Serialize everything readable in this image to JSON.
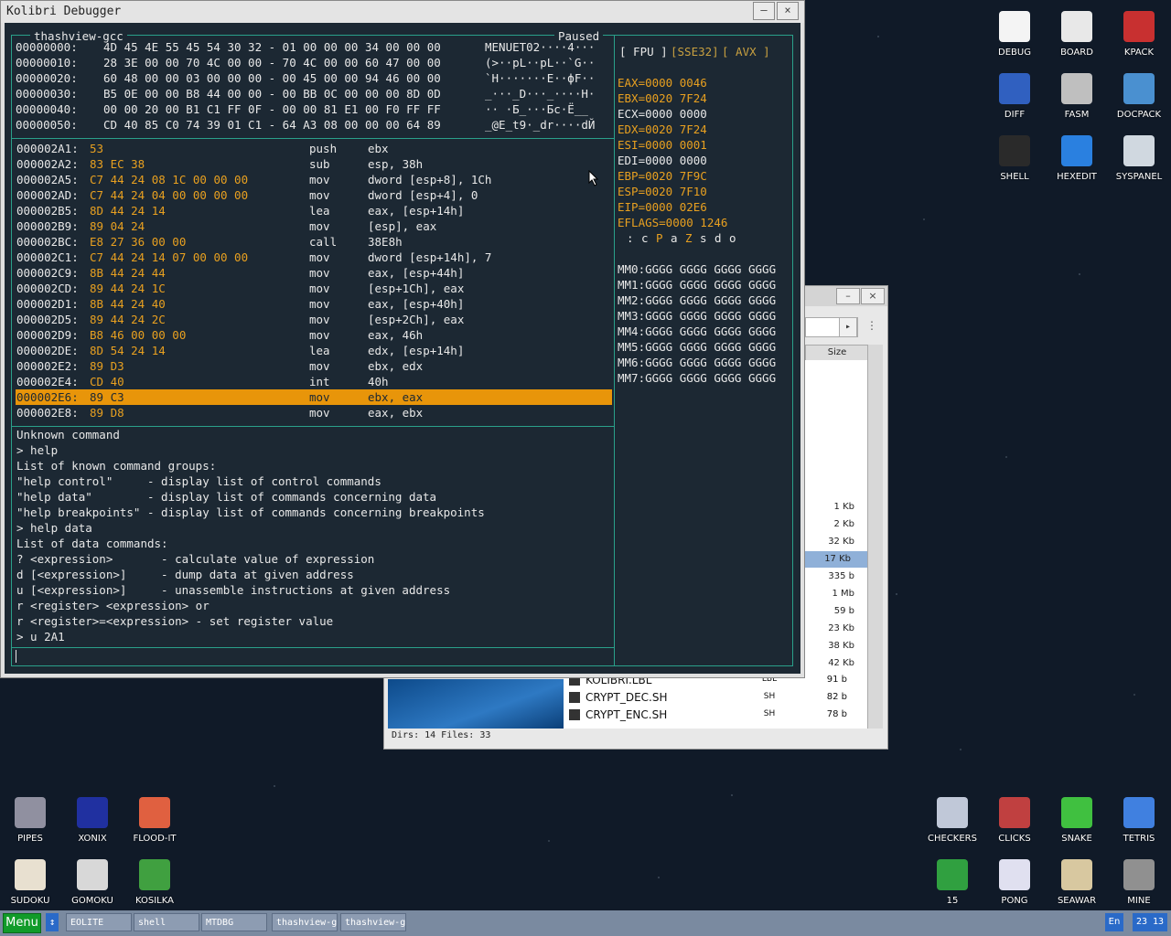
{
  "window": {
    "title": "Kolibri Debugger",
    "minimize": "–",
    "close": "×",
    "program": "thashview-gcc",
    "status": "Paused"
  },
  "dump": [
    {
      "addr": "00000000:",
      "hex": "4D 45 4E 55 45 54 30 32 - 01 00 00 00 34 00 00 00",
      "ascii": "MENUET02····4···"
    },
    {
      "addr": "00000010:",
      "hex": "28 3E 00 00 70 4C 00 00 - 70 4C 00 00 60 47 00 00",
      "ascii": "(>··pL··pL··`G··"
    },
    {
      "addr": "00000020:",
      "hex": "60 48 00 00 03 00 00 00 - 00 45 00 00 94 46 00 00",
      "ascii": "`H·······E··фF··"
    },
    {
      "addr": "00000030:",
      "hex": "B5 0E 00 00 B8 44 00 00 - 00 BB 0C 00 00 00 8D 0D",
      "ascii": "_···_D···_····Н·"
    },
    {
      "addr": "00000040:",
      "hex": "00 00 20 00 B1 C1 FF 0F - 00 00 81 E1 00 F0 FF FF",
      "ascii": "·· ·Б_···Бс·Ё__"
    },
    {
      "addr": "00000050:",
      "hex": "CD 40 85 C0 74 39 01 C1 - 64 A3 08 00 00 00 64 89",
      "ascii": "_@Е_t9·_dr····dЙ"
    }
  ],
  "disasm": [
    {
      "addr": "000002A1:",
      "bytes": "53",
      "mnem": "push",
      "ops": "ebx"
    },
    {
      "addr": "000002A2:",
      "bytes": "83 EC 38",
      "mnem": "sub",
      "ops": "esp, 38h"
    },
    {
      "addr": "000002A5:",
      "bytes": "C7 44 24 08 1C 00 00 00",
      "mnem": "mov",
      "ops": "dword [esp+8], 1Ch"
    },
    {
      "addr": "000002AD:",
      "bytes": "C7 44 24 04 00 00 00 00",
      "mnem": "mov",
      "ops": "dword [esp+4], 0"
    },
    {
      "addr": "000002B5:",
      "bytes": "8D 44 24 14",
      "mnem": "lea",
      "ops": "eax, [esp+14h]"
    },
    {
      "addr": "000002B9:",
      "bytes": "89 04 24",
      "mnem": "mov",
      "ops": "[esp], eax"
    },
    {
      "addr": "000002BC:",
      "bytes": "E8 27 36 00 00",
      "mnem": "call",
      "ops": "38E8h"
    },
    {
      "addr": "000002C1:",
      "bytes": "C7 44 24 14 07 00 00 00",
      "mnem": "mov",
      "ops": "dword [esp+14h], 7"
    },
    {
      "addr": "000002C9:",
      "bytes": "8B 44 24 44",
      "mnem": "mov",
      "ops": "eax, [esp+44h]"
    },
    {
      "addr": "000002CD:",
      "bytes": "89 44 24 1C",
      "mnem": "mov",
      "ops": "[esp+1Ch], eax"
    },
    {
      "addr": "000002D1:",
      "bytes": "8B 44 24 40",
      "mnem": "mov",
      "ops": "eax, [esp+40h]"
    },
    {
      "addr": "000002D5:",
      "bytes": "89 44 24 2C",
      "mnem": "mov",
      "ops": "[esp+2Ch], eax"
    },
    {
      "addr": "000002D9:",
      "bytes": "B8 46 00 00 00",
      "mnem": "mov",
      "ops": "eax, 46h"
    },
    {
      "addr": "000002DE:",
      "bytes": "8D 54 24 14",
      "mnem": "lea",
      "ops": "edx, [esp+14h]"
    },
    {
      "addr": "000002E2:",
      "bytes": "89 D3",
      "mnem": "mov",
      "ops": "ebx, edx"
    },
    {
      "addr": "000002E4:",
      "bytes": "CD 40",
      "mnem": "int",
      "ops": "40h"
    },
    {
      "addr": "000002E6:",
      "bytes": "89 C3",
      "mnem": "mov",
      "ops": "ebx, eax",
      "current": true
    },
    {
      "addr": "000002E8:",
      "bytes": "89 D8",
      "mnem": "mov",
      "ops": "eax, ebx"
    }
  ],
  "console": [
    "Unknown command",
    "> help",
    "List of known command groups:",
    "\"help control\"     - display list of control commands",
    "\"help data\"        - display list of commands concerning data",
    "\"help breakpoints\" - display list of commands concerning breakpoints",
    "> help data",
    "List of data commands:",
    "? <expression>       - calculate value of expression",
    "d [<expression>]     - dump data at given address",
    "u [<expression>]     - unassemble instructions at given address",
    "r <register> <expression> or",
    "r <register>=<expression> - set register value",
    "> u 2A1"
  ],
  "command_input": "",
  "reg_tabs": {
    "fpu": "[ FPU ]",
    "sse": "[SSE32]",
    "avx": "[ AVX ]"
  },
  "registers": [
    {
      "text": "EAX=0000 0046",
      "changed": true
    },
    {
      "text": "EBX=0020 7F24",
      "changed": true
    },
    {
      "text": "ECX=0000 0000",
      "changed": false
    },
    {
      "text": "EDX=0020 7F24",
      "changed": true
    },
    {
      "text": "ESI=0000 0001",
      "changed": true
    },
    {
      "text": "EDI=0000 0000",
      "changed": false
    },
    {
      "text": "EBP=0020 7F9C",
      "changed": true
    },
    {
      "text": "ESP=0020 7F10",
      "changed": true
    },
    {
      "text": "EIP=0000 02E6",
      "changed": true
    },
    {
      "text": "EFLAGS=0000 1246",
      "changed": true
    }
  ],
  "flags": [
    {
      "ch": ":",
      "set": false
    },
    {
      "ch": "c",
      "set": false
    },
    {
      "ch": "P",
      "set": true
    },
    {
      "ch": "a",
      "set": false
    },
    {
      "ch": "Z",
      "set": true
    },
    {
      "ch": "s",
      "set": false
    },
    {
      "ch": "d",
      "set": false
    },
    {
      "ch": "o",
      "set": false
    }
  ],
  "mmx": [
    "MM0:GGGG GGGG GGGG GGGG",
    "MM1:GGGG GGGG GGGG GGGG",
    "MM2:GGGG GGGG GGGG GGGG",
    "MM3:GGGG GGGG GGGG GGGG",
    "MM4:GGGG GGGG GGGG GGGG",
    "MM5:GGGG GGGG GGGG GGGG",
    "MM6:GGGG GGGG GGGG GGGG",
    "MM7:GGGG GGGG GGGG GGGG"
  ],
  "file_manager": {
    "size_header": "Size",
    "sizes": [
      "1 Kb",
      "2 Kb",
      "32 Kb",
      "17 Kb",
      "335 b",
      "1 Mb",
      "59 b",
      "23 Kb",
      "38 Kb",
      "42 Kb"
    ],
    "selected_size_index": 3,
    "files": [
      {
        "name": "KOLIBRI.LBL",
        "ext": "LBL",
        "size": "91 b"
      },
      {
        "name": "CRYPT_DEC.SH",
        "ext": "SH",
        "size": "82 b"
      },
      {
        "name": "CRYPT_ENC.SH",
        "ext": "SH",
        "size": "78 b"
      }
    ],
    "status": "Dirs: 14  Files: 33"
  },
  "desktop_icons_top": [
    {
      "label": "DEBUG",
      "icon": "debug-icon",
      "color": "#f4f4f4"
    },
    {
      "label": "BOARD",
      "icon": "board-icon",
      "color": "#e8e8e8"
    },
    {
      "label": "KPACK",
      "icon": "kpack-icon",
      "color": "#c83030"
    },
    {
      "label": "DIFF",
      "icon": "diff-icon",
      "color": "#3060c0"
    },
    {
      "label": "FASM",
      "icon": "fasm-icon",
      "color": "#bfbfbf"
    },
    {
      "label": "DOCPACK",
      "icon": "docpack-icon",
      "color": "#4a90d0"
    },
    {
      "label": "SHELL",
      "icon": "shell-icon",
      "color": "#2a2a2a"
    },
    {
      "label": "HEXEDIT",
      "icon": "hexedit-icon",
      "color": "#2a80e0"
    },
    {
      "label": "SYSPANEL",
      "icon": "syspanel-icon",
      "color": "#d0d8e0"
    }
  ],
  "desktop_icons_bottom_left": [
    {
      "label": "PIPES",
      "icon": "pipes-icon",
      "color": "#9090a0"
    },
    {
      "label": "XONIX",
      "icon": "xonix-icon",
      "color": "#2030a0"
    },
    {
      "label": "FLOOD-IT",
      "icon": "flood-it-icon",
      "color": "#e06040"
    },
    {
      "label": "SUDOKU",
      "icon": "sudoku-icon",
      "color": "#e8e0d0"
    },
    {
      "label": "GOMOKU",
      "icon": "gomoku-icon",
      "color": "#d8d8d8"
    },
    {
      "label": "KOSILKA",
      "icon": "kosilka-icon",
      "color": "#40a040"
    }
  ],
  "desktop_icons_bottom_right": [
    {
      "label": "CHECKERS",
      "icon": "checkers-icon",
      "color": "#c0c8d8"
    },
    {
      "label": "CLICKS",
      "icon": "clicks-icon",
      "color": "#c04040"
    },
    {
      "label": "SNAKE",
      "icon": "snake-icon",
      "color": "#40c040"
    },
    {
      "label": "TETRIS",
      "icon": "tetris-icon",
      "color": "#4080e0"
    },
    {
      "label": "15",
      "icon": "fifteen-icon",
      "color": "#30a040"
    },
    {
      "label": "PONG",
      "icon": "pong-icon",
      "color": "#e0e0f0"
    },
    {
      "label": "SEAWAR",
      "icon": "seawar-icon",
      "color": "#d8c8a0"
    },
    {
      "label": "MINE",
      "icon": "mine-icon",
      "color": "#909090"
    }
  ],
  "taskbar": {
    "menu": "Menu",
    "tasks": [
      "EOLITE",
      "shell",
      "MTDBG",
      "thashview-g",
      "thashview-g"
    ],
    "lang": "En",
    "clock": "23 13"
  }
}
